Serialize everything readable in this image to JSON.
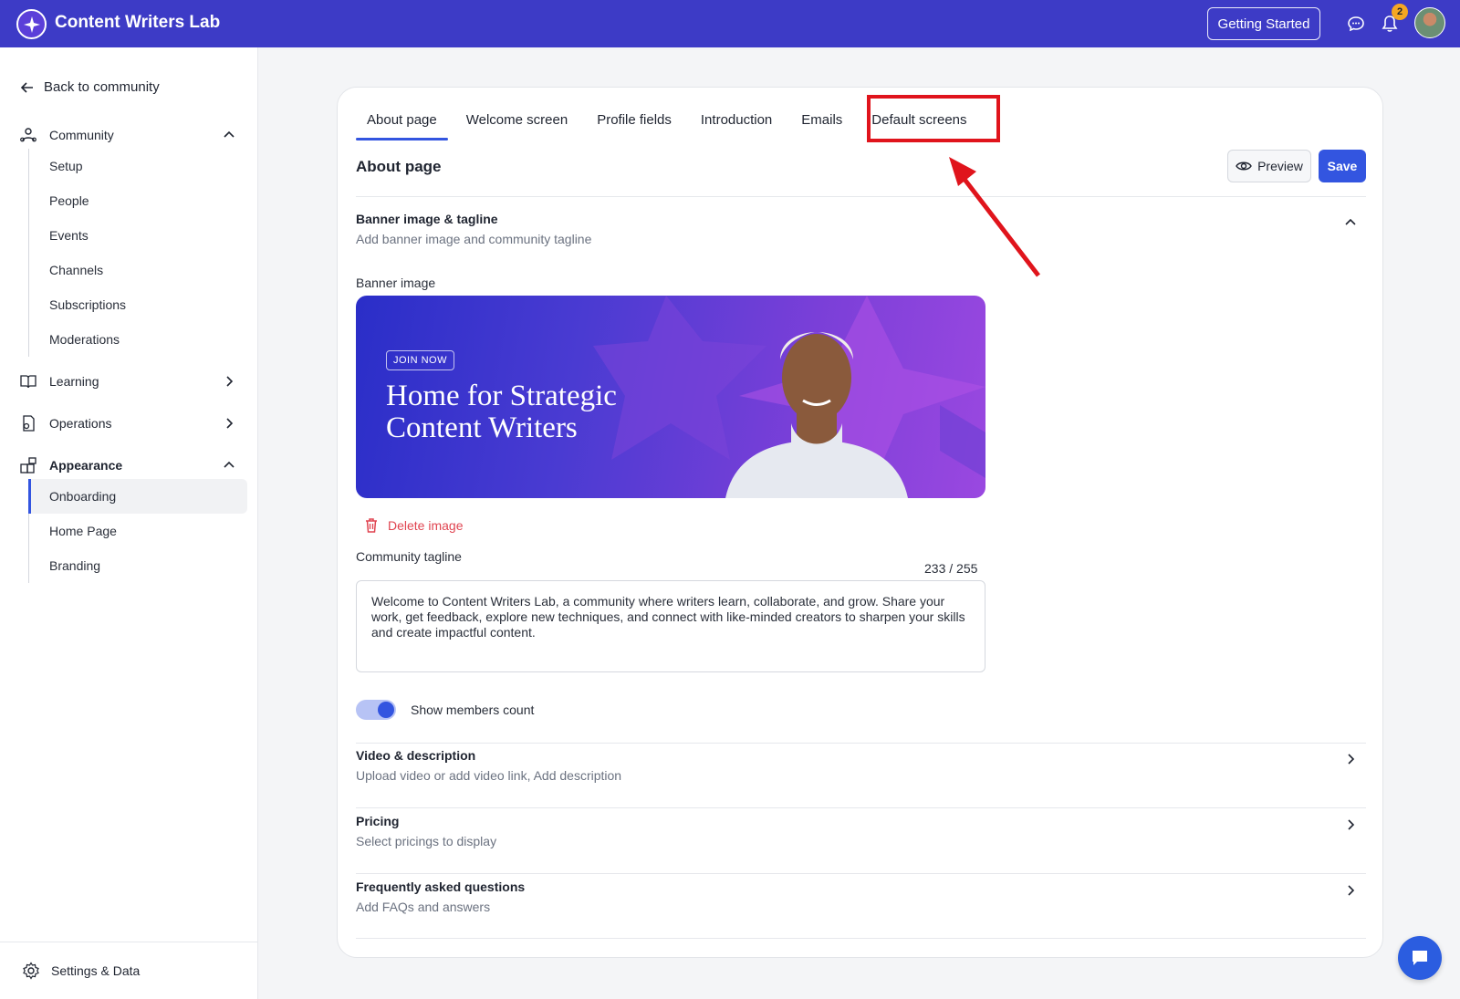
{
  "app": {
    "title": "Content Writers Lab",
    "getting_started": "Getting Started",
    "notification_count": "2"
  },
  "sidebar": {
    "back_label": "Back to community",
    "community": {
      "label": "Community",
      "items": [
        "Setup",
        "People",
        "Events",
        "Channels",
        "Subscriptions",
        "Moderations"
      ]
    },
    "learning": {
      "label": "Learning"
    },
    "operations": {
      "label": "Operations"
    },
    "appearance": {
      "label": "Appearance",
      "items": [
        "Onboarding",
        "Home Page",
        "Branding"
      ],
      "active": "Onboarding"
    },
    "settings_label": "Settings & Data"
  },
  "tabs": [
    "About page",
    "Welcome screen",
    "Profile fields",
    "Introduction",
    "Emails",
    "Default screens"
  ],
  "active_tab": "About page",
  "page": {
    "heading": "About page",
    "preview_label": "Preview",
    "save_label": "Save"
  },
  "banner_section": {
    "title": "Banner image & tagline",
    "subtitle": "Add banner image and community tagline",
    "banner_label": "Banner image",
    "banner_chip": "JOIN NOW",
    "banner_heading": "Home for Strategic Content Writers",
    "delete_label": "Delete image",
    "tagline_label": "Community tagline",
    "char_count": "233 / 255",
    "tagline_value": "Welcome to Content Writers Lab, a community where writers learn, collaborate, and grow. Share your work, get feedback, explore new techniques, and connect with like-minded creators to sharpen your skills and create impactful content.",
    "toggle_label": "Show members count",
    "toggle_on": true
  },
  "sections": [
    {
      "title": "Video & description",
      "subtitle": "Upload video or add video link, Add description"
    },
    {
      "title": "Pricing",
      "subtitle": "Select pricings to display"
    },
    {
      "title": "Frequently asked questions",
      "subtitle": "Add FAQs and answers"
    }
  ],
  "colors": {
    "brand": "#3d3bc6",
    "accent": "#3355e0",
    "danger": "#e04450",
    "highlight": "#e0141c"
  }
}
